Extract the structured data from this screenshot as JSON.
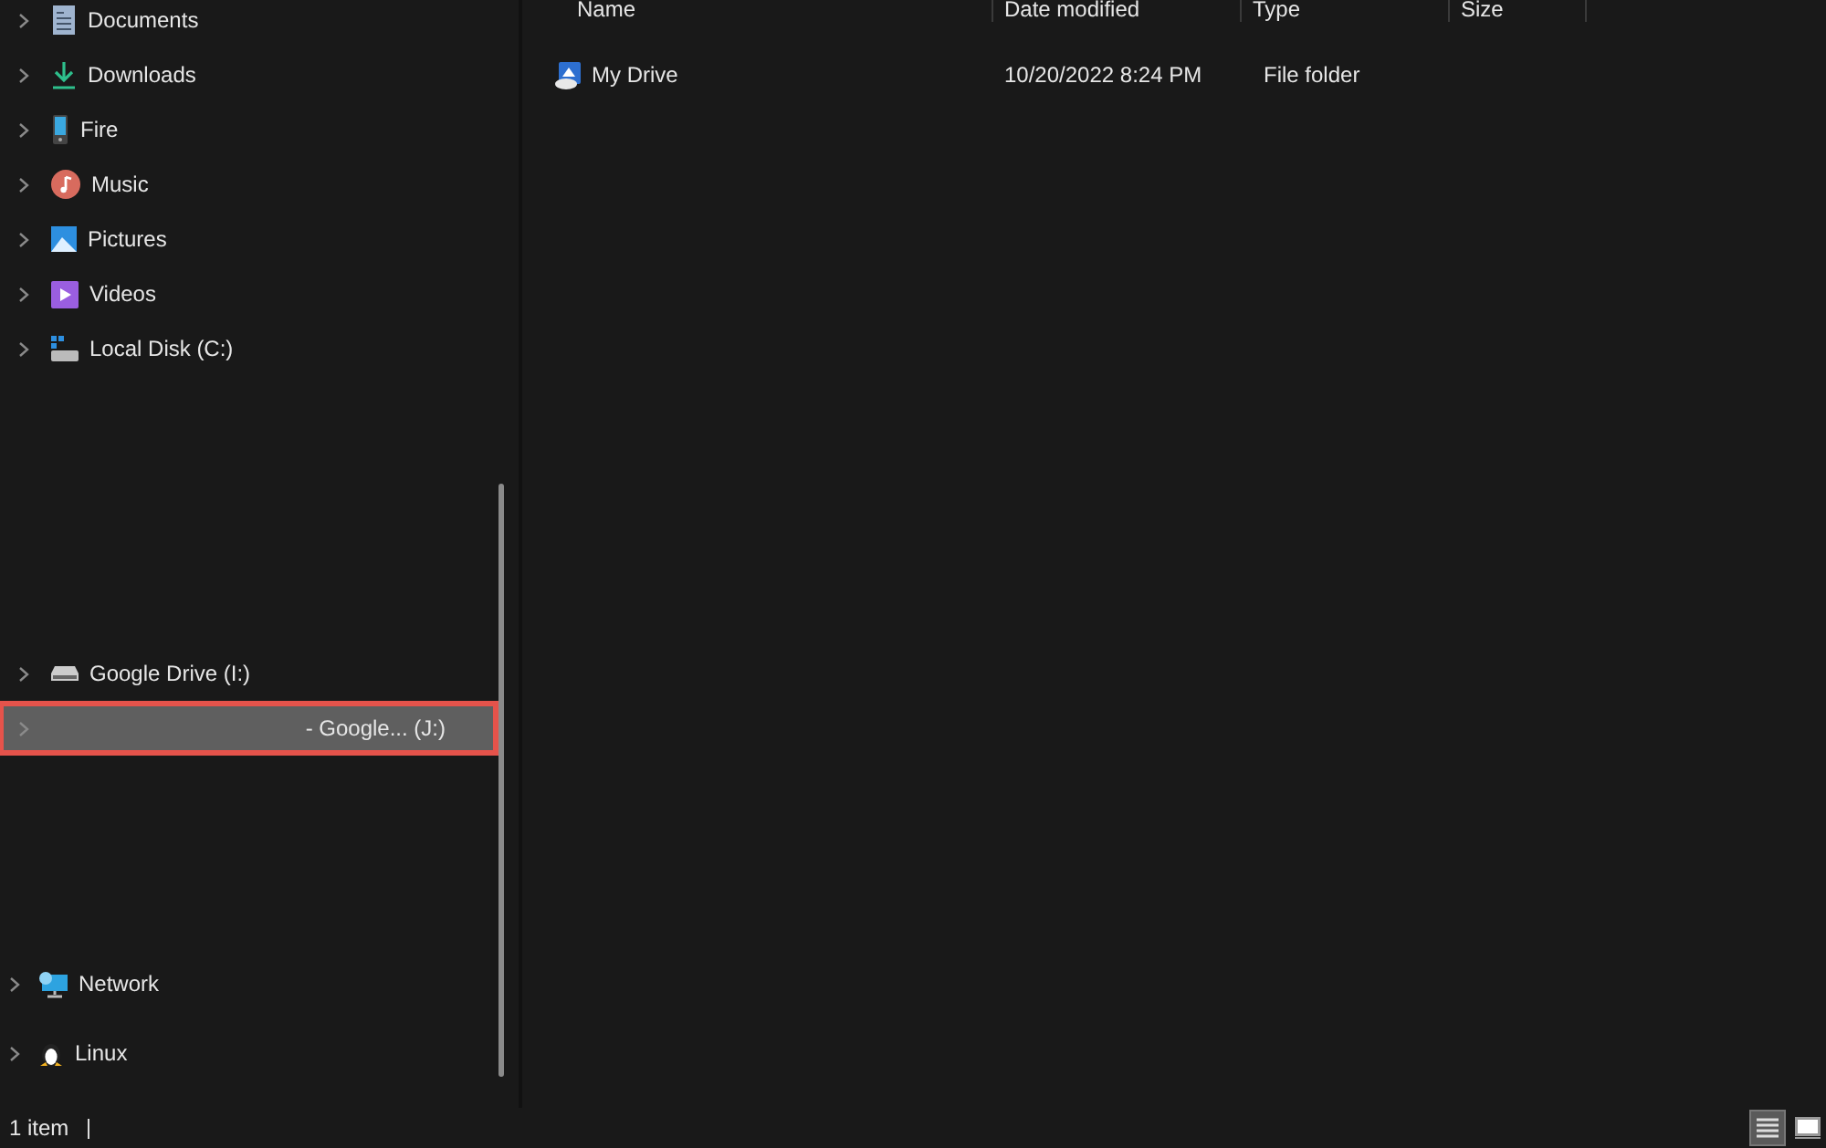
{
  "sidebar": {
    "groups": [
      {
        "items": [
          {
            "label": "Documents",
            "kind": "documents",
            "selected": false
          },
          {
            "label": "Downloads",
            "kind": "downloads",
            "selected": false
          },
          {
            "label": "Fire",
            "kind": "device",
            "selected": false
          },
          {
            "label": "Music",
            "kind": "music",
            "selected": false
          },
          {
            "label": "Pictures",
            "kind": "pictures",
            "selected": false
          },
          {
            "label": "Videos",
            "kind": "videos",
            "selected": false
          },
          {
            "label": "Local Disk (C:)",
            "kind": "disk",
            "selected": false
          }
        ]
      },
      {
        "items": [
          {
            "label": "Google Drive (I:)",
            "kind": "drive",
            "selected": false
          },
          {
            "label": "- Google... (J:)",
            "kind": "none",
            "selected": true
          }
        ]
      },
      {
        "items": [
          {
            "label": "Network",
            "kind": "network",
            "selected": false
          },
          {
            "label": "Linux",
            "kind": "linux",
            "selected": false
          }
        ]
      }
    ]
  },
  "table": {
    "columns": [
      "Name",
      "Date modified",
      "Type",
      "Size"
    ],
    "rows": [
      {
        "name": "My Drive",
        "date_modified": "10/20/2022 8:24 PM",
        "type": "File folder"
      }
    ]
  },
  "status_bar": {
    "count": "1 item",
    "view_buttons": [
      {
        "kind": "details",
        "selected": true
      },
      {
        "kind": "thumbnails",
        "selected": false
      }
    ]
  }
}
